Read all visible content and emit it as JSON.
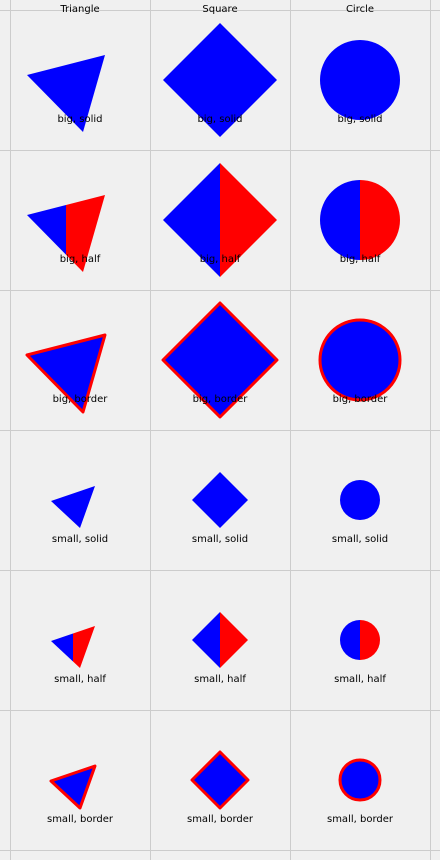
{
  "columns": [
    {
      "key": "triangle",
      "header": "Triangle"
    },
    {
      "key": "square",
      "header": "Square"
    },
    {
      "key": "circle",
      "header": "Circle"
    }
  ],
  "rows": [
    {
      "size": "big",
      "style": "solid",
      "label": "big, solid"
    },
    {
      "size": "big",
      "style": "half",
      "label": "big, half"
    },
    {
      "size": "big",
      "style": "border",
      "label": "big, border"
    },
    {
      "size": "small",
      "style": "solid",
      "label": "small, solid"
    },
    {
      "size": "small",
      "style": "half",
      "label": "small, half"
    },
    {
      "size": "small",
      "style": "border",
      "label": "small, border"
    }
  ],
  "colors": {
    "background": "#f0f0f0",
    "grid": "#cccccc",
    "fill": "#0000ff",
    "accent": "#ff0000",
    "text": "#000000"
  }
}
